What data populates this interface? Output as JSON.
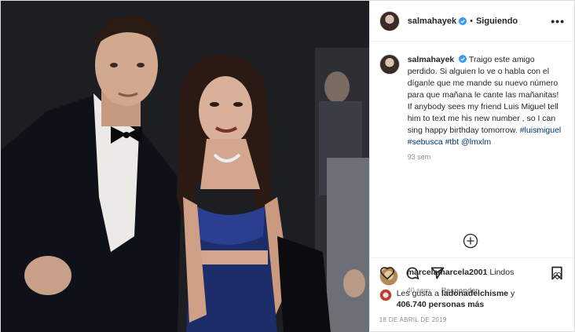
{
  "post": {
    "author": "salmahayek",
    "separator": "•",
    "follow_status": "Siguiendo",
    "more_glyph": "•••",
    "caption_author": "salmahayek",
    "caption_text": "Traigo este amigo perdido. Si alguien lo ve o habla con el díganle que me mande su nuevo número para que mañana le cante las mañanitas! If anybody sees my friend Luis Miguel tell him to text me his new number , so I can sing happy birthday tomorrow.",
    "caption_tags": [
      "#luismiguel",
      "#sebusca",
      "#tbt",
      "@lmxlm"
    ],
    "caption_age": "93 sem",
    "comments": [
      {
        "user": "marcelamarcela2001",
        "text": "Lindos",
        "age": "40 sem",
        "reply_label": "Responder"
      }
    ],
    "likes_prefix": "Les gusta a ",
    "likes_user": "ladonadelchisme",
    "likes_mid": " y",
    "likes_count": "406.740",
    "likes_suffix": " personas más",
    "date": "18 DE ABRIL DE 2019"
  },
  "icons": {
    "verified": "verified-badge-icon",
    "more": "more-options-icon",
    "load_more": "plus-circle-icon",
    "like": "heart-icon",
    "comment": "comment-icon",
    "share": "share-icon",
    "save": "bookmark-icon"
  },
  "colors": {
    "link": "#00376b",
    "verified": "#3897f0",
    "muted": "#8e8e8e",
    "border": "#dbdbdb"
  }
}
